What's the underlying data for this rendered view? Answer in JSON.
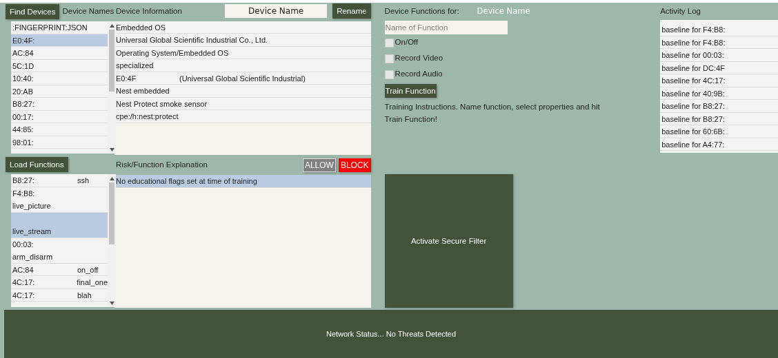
{
  "devices_panel": {
    "button": "Find Devices",
    "title": "Device Names",
    "items": [
      {
        "label": ":FINGERPRINT:JSON",
        "selected": false
      },
      {
        "label": "E0:4F:",
        "selected": true
      },
      {
        "label": "AC:84",
        "selected": false
      },
      {
        "label": "5C:1D",
        "selected": false
      },
      {
        "label": "10:40:",
        "selected": false
      },
      {
        "label": "20:AB",
        "selected": false
      },
      {
        "label": "B8:27:",
        "selected": false
      },
      {
        "label": "00:17:",
        "selected": false
      },
      {
        "label": "44:85:",
        "selected": false
      },
      {
        "label": "98:01:",
        "selected": false
      }
    ]
  },
  "info_panel": {
    "title": "Device Information",
    "name_field": "Device Name",
    "button": "Rename",
    "rows": [
      {
        "cells": [
          "Embedded OS"
        ]
      },
      {
        "cells": [
          "Universal Global Scientific Industrial Co., Ltd."
        ]
      },
      {
        "cells": [
          "Operating System/Embedded OS"
        ]
      },
      {
        "cells": [
          "specialized"
        ]
      },
      {
        "cells": [
          "E0:4F",
          "(Universal Global Scientific Industrial)"
        ]
      },
      {
        "cells": [
          "Nest embedded"
        ]
      },
      {
        "cells": [
          "Nest Protect smoke sensor"
        ]
      },
      {
        "cells": [
          "cpe:/h:nest:protect"
        ]
      }
    ]
  },
  "functions_panel": {
    "button": "Load Functions",
    "items": [
      {
        "kind": "inline",
        "mac": "B8:27:",
        "function": "ssh",
        "selected": false
      },
      {
        "kind": "stacked",
        "mac": "F4:B8:",
        "function": "live_picture",
        "selected": false
      },
      {
        "kind": "stacked",
        "function": "live_stream",
        "selected": true
      },
      {
        "kind": "stacked",
        "mac": "00:03:",
        "function": "arm_disarm",
        "selected": false
      },
      {
        "kind": "inline",
        "mac": "AC:84",
        "function": "on_off",
        "selected": false
      },
      {
        "kind": "inline",
        "mac": "4C:17:",
        "function": "final_one",
        "selected": false
      },
      {
        "kind": "inline",
        "mac": "4C:17:",
        "function": "blah",
        "selected": false
      }
    ]
  },
  "risk_panel": {
    "title": "Risk/Function Explanation",
    "allow_button": "ALLOW",
    "block_button": "BLOCK",
    "items": [
      {
        "label": "No educational flags set at time of training",
        "selected": true
      }
    ]
  },
  "training": {
    "title": "Device Functions for:",
    "device_name": "Device Name",
    "placeholder": "Name of Function",
    "options": [
      {
        "label": "On/Off",
        "checked": false
      },
      {
        "label": "Record Video",
        "checked": false
      },
      {
        "label": "Record Audio",
        "checked": false
      }
    ],
    "button": "Train Function",
    "instructions": "Training Instructions. Name function, select properties and hit Train Function!",
    "filter_button": "Activate Secure Filter"
  },
  "activity_log": {
    "title": "Activity Log",
    "items": [
      "baseline for F4:B8:",
      "baseline for F4:B8:",
      "baseline for 00:03:",
      "baseline for DC:4F",
      "baseline for 4C:17:",
      "baseline for 40:9B:",
      "baseline for B8:27:",
      "baseline for B8:27:",
      "baseline for 60:6B:",
      "baseline for A4:77:"
    ]
  },
  "status_bar": "Network Status... No Threats Detected"
}
